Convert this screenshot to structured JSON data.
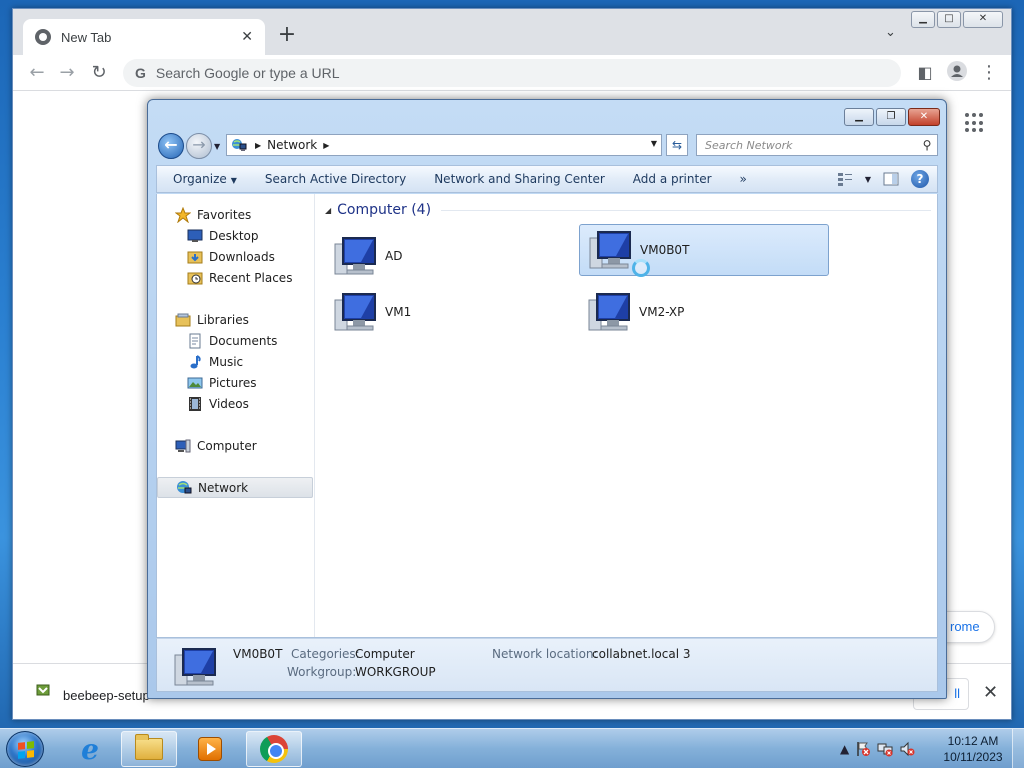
{
  "chrome": {
    "tab_title": "New Tab",
    "tab_close": "✕",
    "new_tab": "+",
    "tab_search": "⌄",
    "back": "←",
    "forward": "→",
    "reload": "↻",
    "omnibox_placeholder": "Search Google or type a URL",
    "customize_label": "rome",
    "download_filename": "beebeep-setup",
    "show_all_label": "ll",
    "shelf_close": "✕"
  },
  "explorer": {
    "address_segments": [
      "Network"
    ],
    "search_placeholder": "Search Network",
    "commands": [
      "Organize",
      "Search Active Directory",
      "Network and Sharing Center",
      "Add a printer",
      "»"
    ],
    "help_label": "?",
    "nav": {
      "favorites": [
        "Favorites",
        "Desktop",
        "Downloads",
        "Recent Places"
      ],
      "libraries": [
        "Libraries",
        "Documents",
        "Music",
        "Pictures",
        "Videos"
      ],
      "computer": "Computer",
      "network": "Network"
    },
    "group_header": "Computer (4)",
    "computers": [
      {
        "name": "AD",
        "selected": false
      },
      {
        "name": "VM0B0T",
        "selected": true
      },
      {
        "name": "VM1",
        "selected": false
      },
      {
        "name": "VM2-XP",
        "selected": false
      }
    ],
    "details": {
      "name": "VM0B0T",
      "categories_label": "Categories:",
      "categories_value": "Computer",
      "workgroup_label": "Workgroup:",
      "workgroup_value": "WORKGROUP",
      "network_location_label": "Network location:",
      "network_location_value": "collabnet.local  3"
    }
  },
  "taskbar": {
    "time": "10:12 AM",
    "date": "10/11/2023",
    "tray_arrow": "▲"
  }
}
